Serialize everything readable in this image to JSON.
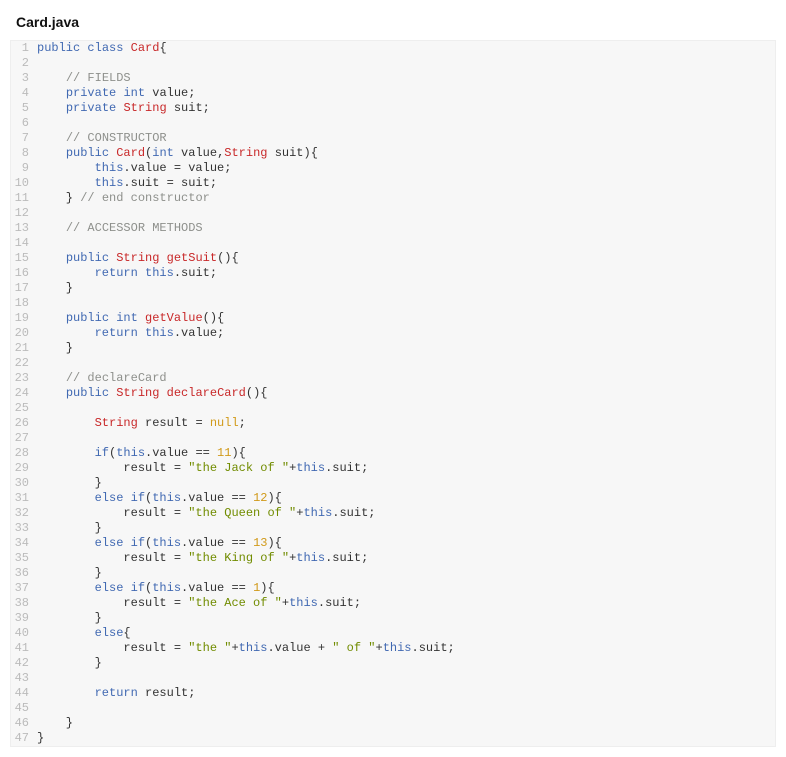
{
  "filename": "Card.java",
  "code_lines": [
    {
      "n": 1,
      "tokens": [
        [
          "k",
          "public"
        ],
        [
          "p",
          " "
        ],
        [
          "k",
          "class"
        ],
        [
          "p",
          " "
        ],
        [
          "t",
          "Card"
        ],
        [
          "p",
          "{"
        ]
      ]
    },
    {
      "n": 2,
      "tokens": []
    },
    {
      "n": 3,
      "tokens": [
        [
          "p",
          "    "
        ],
        [
          "c",
          "// FIELDS"
        ]
      ]
    },
    {
      "n": 4,
      "tokens": [
        [
          "p",
          "    "
        ],
        [
          "k",
          "private"
        ],
        [
          "p",
          " "
        ],
        [
          "k",
          "int"
        ],
        [
          "p",
          " value;"
        ]
      ]
    },
    {
      "n": 5,
      "tokens": [
        [
          "p",
          "    "
        ],
        [
          "k",
          "private"
        ],
        [
          "p",
          " "
        ],
        [
          "t",
          "String"
        ],
        [
          "p",
          " suit;"
        ]
      ]
    },
    {
      "n": 6,
      "tokens": []
    },
    {
      "n": 7,
      "tokens": [
        [
          "p",
          "    "
        ],
        [
          "c",
          "// CONSTRUCTOR"
        ]
      ]
    },
    {
      "n": 8,
      "tokens": [
        [
          "p",
          "    "
        ],
        [
          "k",
          "public"
        ],
        [
          "p",
          " "
        ],
        [
          "m",
          "Card"
        ],
        [
          "p",
          "("
        ],
        [
          "k",
          "int"
        ],
        [
          "p",
          " value,"
        ],
        [
          "t",
          "String"
        ],
        [
          "p",
          " suit){"
        ]
      ]
    },
    {
      "n": 9,
      "tokens": [
        [
          "p",
          "        "
        ],
        [
          "kw2",
          "this"
        ],
        [
          "p",
          ".value = value;"
        ]
      ]
    },
    {
      "n": 10,
      "tokens": [
        [
          "p",
          "        "
        ],
        [
          "kw2",
          "this"
        ],
        [
          "p",
          ".suit = suit;"
        ]
      ]
    },
    {
      "n": 11,
      "tokens": [
        [
          "p",
          "    } "
        ],
        [
          "c",
          "// end constructor"
        ]
      ]
    },
    {
      "n": 12,
      "tokens": []
    },
    {
      "n": 13,
      "tokens": [
        [
          "p",
          "    "
        ],
        [
          "c",
          "// ACCESSOR METHODS"
        ]
      ]
    },
    {
      "n": 14,
      "tokens": []
    },
    {
      "n": 15,
      "tokens": [
        [
          "p",
          "    "
        ],
        [
          "k",
          "public"
        ],
        [
          "p",
          " "
        ],
        [
          "t",
          "String"
        ],
        [
          "p",
          " "
        ],
        [
          "m",
          "getSuit"
        ],
        [
          "p",
          "(){"
        ]
      ]
    },
    {
      "n": 16,
      "tokens": [
        [
          "p",
          "        "
        ],
        [
          "k",
          "return"
        ],
        [
          "p",
          " "
        ],
        [
          "kw2",
          "this"
        ],
        [
          "p",
          ".suit;"
        ]
      ]
    },
    {
      "n": 17,
      "tokens": [
        [
          "p",
          "    }"
        ]
      ]
    },
    {
      "n": 18,
      "tokens": []
    },
    {
      "n": 19,
      "tokens": [
        [
          "p",
          "    "
        ],
        [
          "k",
          "public"
        ],
        [
          "p",
          " "
        ],
        [
          "k",
          "int"
        ],
        [
          "p",
          " "
        ],
        [
          "m",
          "getValue"
        ],
        [
          "p",
          "(){"
        ]
      ]
    },
    {
      "n": 20,
      "tokens": [
        [
          "p",
          "        "
        ],
        [
          "k",
          "return"
        ],
        [
          "p",
          " "
        ],
        [
          "kw2",
          "this"
        ],
        [
          "p",
          ".value;"
        ]
      ]
    },
    {
      "n": 21,
      "tokens": [
        [
          "p",
          "    }"
        ]
      ]
    },
    {
      "n": 22,
      "tokens": []
    },
    {
      "n": 23,
      "tokens": [
        [
          "p",
          "    "
        ],
        [
          "c",
          "// declareCard"
        ]
      ]
    },
    {
      "n": 24,
      "tokens": [
        [
          "p",
          "    "
        ],
        [
          "k",
          "public"
        ],
        [
          "p",
          " "
        ],
        [
          "t",
          "String"
        ],
        [
          "p",
          " "
        ],
        [
          "m",
          "declareCard"
        ],
        [
          "p",
          "(){"
        ]
      ]
    },
    {
      "n": 25,
      "tokens": []
    },
    {
      "n": 26,
      "tokens": [
        [
          "p",
          "        "
        ],
        [
          "t",
          "String"
        ],
        [
          "p",
          " result = "
        ],
        [
          "n",
          "null"
        ],
        [
          "p",
          ";"
        ]
      ]
    },
    {
      "n": 27,
      "tokens": []
    },
    {
      "n": 28,
      "tokens": [
        [
          "p",
          "        "
        ],
        [
          "k",
          "if"
        ],
        [
          "p",
          "("
        ],
        [
          "kw2",
          "this"
        ],
        [
          "p",
          ".value == "
        ],
        [
          "n",
          "11"
        ],
        [
          "p",
          "){"
        ]
      ]
    },
    {
      "n": 29,
      "tokens": [
        [
          "p",
          "            result = "
        ],
        [
          "s",
          "\"the Jack of \""
        ],
        [
          "p",
          "+"
        ],
        [
          "kw2",
          "this"
        ],
        [
          "p",
          ".suit;"
        ]
      ]
    },
    {
      "n": 30,
      "tokens": [
        [
          "p",
          "        }"
        ]
      ]
    },
    {
      "n": 31,
      "tokens": [
        [
          "p",
          "        "
        ],
        [
          "k",
          "else"
        ],
        [
          "p",
          " "
        ],
        [
          "k",
          "if"
        ],
        [
          "p",
          "("
        ],
        [
          "kw2",
          "this"
        ],
        [
          "p",
          ".value == "
        ],
        [
          "n",
          "12"
        ],
        [
          "p",
          "){"
        ]
      ]
    },
    {
      "n": 32,
      "tokens": [
        [
          "p",
          "            result = "
        ],
        [
          "s",
          "\"the Queen of \""
        ],
        [
          "p",
          "+"
        ],
        [
          "kw2",
          "this"
        ],
        [
          "p",
          ".suit;"
        ]
      ]
    },
    {
      "n": 33,
      "tokens": [
        [
          "p",
          "        }"
        ]
      ]
    },
    {
      "n": 34,
      "tokens": [
        [
          "p",
          "        "
        ],
        [
          "k",
          "else"
        ],
        [
          "p",
          " "
        ],
        [
          "k",
          "if"
        ],
        [
          "p",
          "("
        ],
        [
          "kw2",
          "this"
        ],
        [
          "p",
          ".value == "
        ],
        [
          "n",
          "13"
        ],
        [
          "p",
          "){"
        ]
      ]
    },
    {
      "n": 35,
      "tokens": [
        [
          "p",
          "            result = "
        ],
        [
          "s",
          "\"the King of \""
        ],
        [
          "p",
          "+"
        ],
        [
          "kw2",
          "this"
        ],
        [
          "p",
          ".suit;"
        ]
      ]
    },
    {
      "n": 36,
      "tokens": [
        [
          "p",
          "        }"
        ]
      ]
    },
    {
      "n": 37,
      "tokens": [
        [
          "p",
          "        "
        ],
        [
          "k",
          "else"
        ],
        [
          "p",
          " "
        ],
        [
          "k",
          "if"
        ],
        [
          "p",
          "("
        ],
        [
          "kw2",
          "this"
        ],
        [
          "p",
          ".value == "
        ],
        [
          "n",
          "1"
        ],
        [
          "p",
          "){"
        ]
      ]
    },
    {
      "n": 38,
      "tokens": [
        [
          "p",
          "            result = "
        ],
        [
          "s",
          "\"the Ace of \""
        ],
        [
          "p",
          "+"
        ],
        [
          "kw2",
          "this"
        ],
        [
          "p",
          ".suit;"
        ]
      ]
    },
    {
      "n": 39,
      "tokens": [
        [
          "p",
          "        }"
        ]
      ]
    },
    {
      "n": 40,
      "tokens": [
        [
          "p",
          "        "
        ],
        [
          "k",
          "else"
        ],
        [
          "p",
          "{"
        ]
      ]
    },
    {
      "n": 41,
      "tokens": [
        [
          "p",
          "            result = "
        ],
        [
          "s",
          "\"the \""
        ],
        [
          "p",
          "+"
        ],
        [
          "kw2",
          "this"
        ],
        [
          "p",
          ".value + "
        ],
        [
          "s",
          "\" of \""
        ],
        [
          "p",
          "+"
        ],
        [
          "kw2",
          "this"
        ],
        [
          "p",
          ".suit;"
        ]
      ]
    },
    {
      "n": 42,
      "tokens": [
        [
          "p",
          "        }"
        ]
      ]
    },
    {
      "n": 43,
      "tokens": []
    },
    {
      "n": 44,
      "tokens": [
        [
          "p",
          "        "
        ],
        [
          "k",
          "return"
        ],
        [
          "p",
          " result;"
        ]
      ]
    },
    {
      "n": 45,
      "tokens": []
    },
    {
      "n": 46,
      "tokens": [
        [
          "p",
          "    }"
        ]
      ]
    },
    {
      "n": 47,
      "tokens": [
        [
          "p",
          "}"
        ]
      ]
    }
  ]
}
